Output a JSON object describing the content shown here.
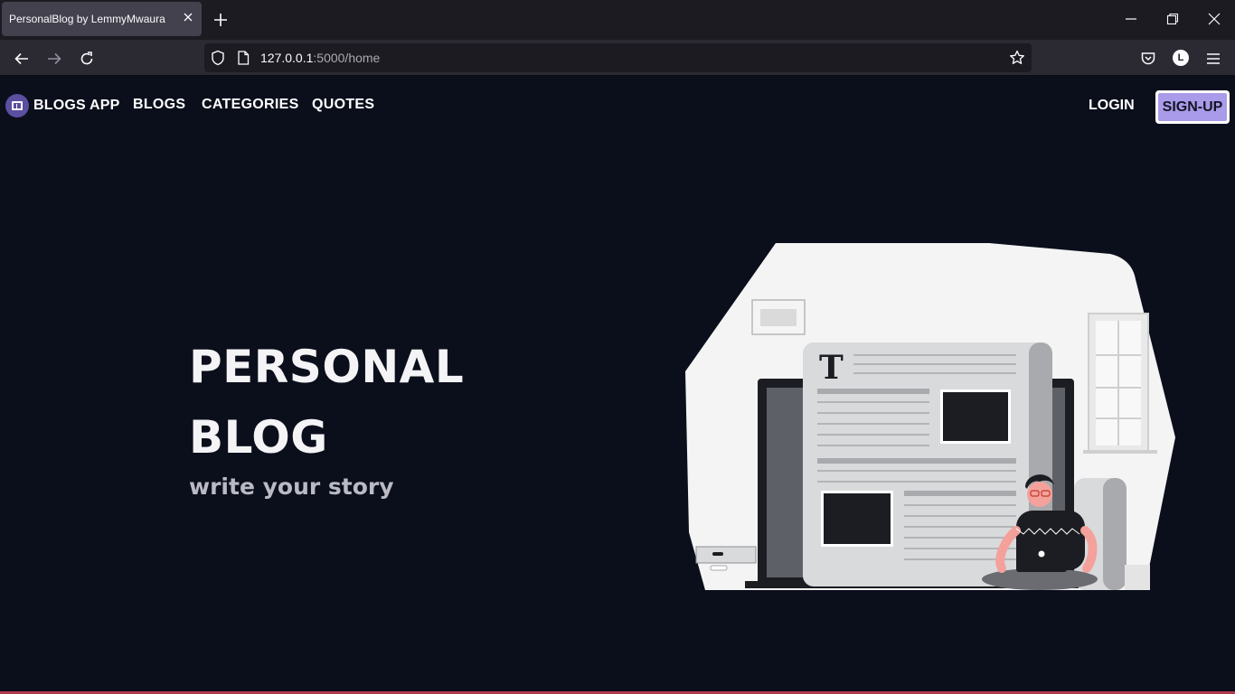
{
  "browser": {
    "tab_title": "PersonalBlog by LemmyMwaura",
    "url_host": "127.0.0.1",
    "url_path": ":5000/home",
    "account_initial": "L"
  },
  "nav": {
    "brand": "BLOGS APP",
    "links": [
      "BLOGS",
      "CATEGORIES",
      "QUOTES"
    ],
    "login": "LOGIN",
    "signup": "SIGN-UP"
  },
  "hero": {
    "title_line1": "PERSONAL",
    "title_line2": "BLOG",
    "subtitle": "write your story",
    "illustration_letter": "T"
  },
  "colors": {
    "page_bg": "#0b0f1c",
    "accent": "#a99be9",
    "brand_logo": "#5b4fa0"
  }
}
